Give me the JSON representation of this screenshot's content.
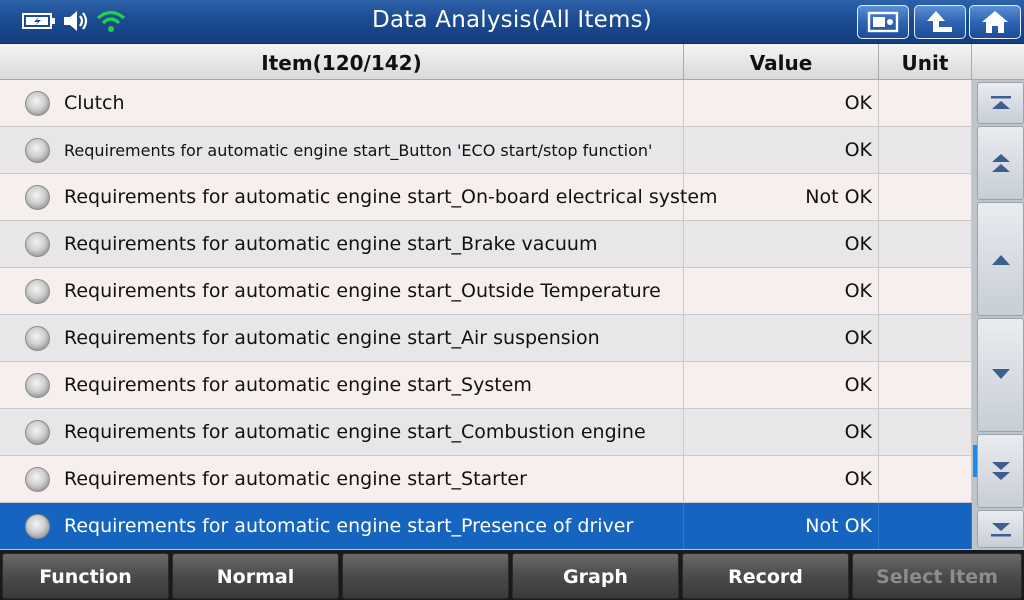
{
  "header": {
    "title": "Data Analysis(All Items)",
    "buttons": [
      {
        "name": "screenshot-button",
        "icon": "camera-icon"
      },
      {
        "name": "back-button",
        "icon": "return-arrow-icon"
      },
      {
        "name": "home-button",
        "icon": "home-icon"
      }
    ],
    "status_icons": [
      "battery-icon",
      "speaker-icon",
      "wifi-icon"
    ]
  },
  "table": {
    "columns": {
      "item": "Item(120/142)",
      "value": "Value",
      "unit": "Unit"
    },
    "rows": [
      {
        "name": "Clutch",
        "value": "OK",
        "unit": ""
      },
      {
        "name": "Requirements for automatic engine start_Button 'ECO start/stop function'",
        "value": "OK",
        "unit": ""
      },
      {
        "name": "Requirements for automatic engine start_On-board electrical system",
        "value": "Not OK",
        "unit": ""
      },
      {
        "name": "Requirements for automatic engine start_Brake vacuum",
        "value": "OK",
        "unit": ""
      },
      {
        "name": "Requirements for automatic engine start_Outside Temperature",
        "value": "OK",
        "unit": ""
      },
      {
        "name": "Requirements for automatic engine start_Air suspension",
        "value": "OK",
        "unit": ""
      },
      {
        "name": "Requirements for automatic engine start_System",
        "value": "OK",
        "unit": ""
      },
      {
        "name": "Requirements for automatic engine start_Combustion engine",
        "value": "OK",
        "unit": ""
      },
      {
        "name": "Requirements for automatic engine start_Starter",
        "value": "OK",
        "unit": ""
      },
      {
        "name": "Requirements for automatic engine start_Presence of driver",
        "value": "Not OK",
        "unit": ""
      }
    ],
    "selected_row": 9
  },
  "scroll": {
    "buttons": [
      "scroll-top-icon",
      "page-up-icon",
      "line-up-icon",
      "line-down-icon",
      "page-down-icon",
      "scroll-bottom-icon"
    ]
  },
  "footer": {
    "function": "Function",
    "normal": "Normal",
    "blank": "",
    "graph": "Graph",
    "record": "Record",
    "select_item": "Select Item"
  },
  "colors": {
    "title_bar": "#1b4c92",
    "selected_row": "#1565c0",
    "wifi": "#22d14a"
  }
}
